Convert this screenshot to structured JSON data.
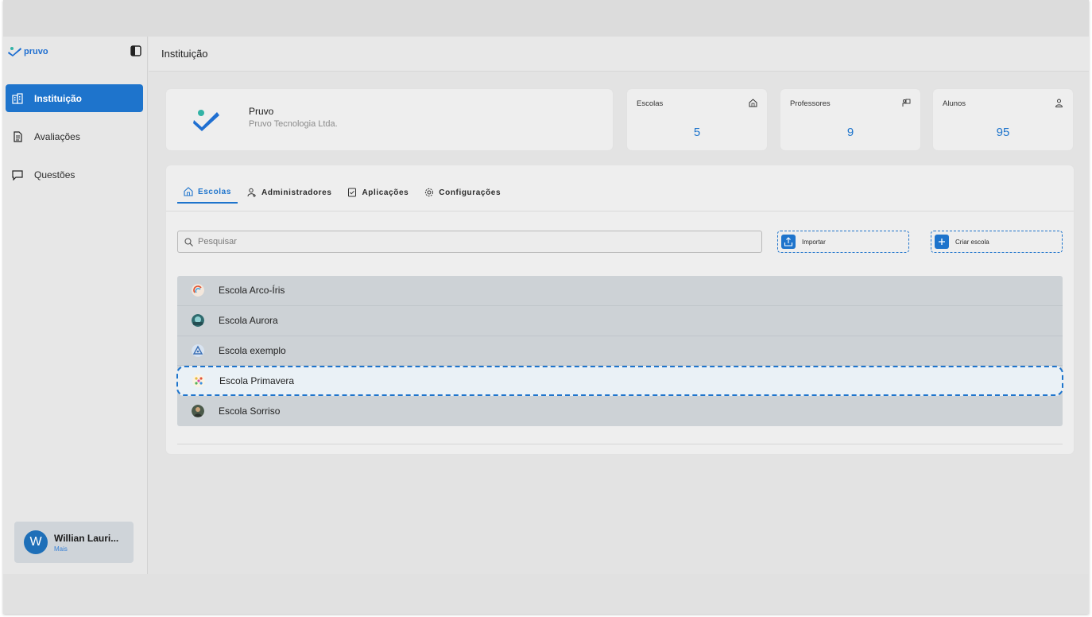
{
  "sidebar": {
    "logo_text": "pruvo",
    "items": [
      {
        "label": "Instituição",
        "icon": "building-icon",
        "active": true
      },
      {
        "label": "Avaliações",
        "icon": "document-icon",
        "active": false
      },
      {
        "label": "Questões",
        "icon": "chat-icon",
        "active": false
      }
    ],
    "user": {
      "initial": "W",
      "name": "Willian Lauri...",
      "sub": "Mais"
    }
  },
  "header": {
    "title": "Instituição"
  },
  "org": {
    "name": "Pruvo",
    "company": "Pruvo Tecnologia Ltda."
  },
  "stats": [
    {
      "label": "Escolas",
      "value": "5",
      "icon": "home-icon"
    },
    {
      "label": "Professores",
      "value": "9",
      "icon": "teacher-icon"
    },
    {
      "label": "Alunos",
      "value": "95",
      "icon": "person-icon"
    }
  ],
  "tabs": [
    {
      "label": "Escolas",
      "icon": "home-icon",
      "active": true
    },
    {
      "label": "Administradores",
      "icon": "admin-icon",
      "active": false
    },
    {
      "label": "Aplicações",
      "icon": "checklist-icon",
      "active": false
    },
    {
      "label": "Configurações",
      "icon": "gear-icon",
      "active": false
    }
  ],
  "search": {
    "placeholder": "Pesquisar"
  },
  "actions": {
    "import_label": "Importar",
    "create_label": "Criar escola"
  },
  "schools": [
    {
      "name": "Escola Arco-Íris",
      "color": "#e07a2e"
    },
    {
      "name": "Escola Aurora",
      "color": "#2f6b6e"
    },
    {
      "name": "Escola exemplo",
      "color": "#3a6fb5"
    },
    {
      "name": "Escola Primavera",
      "color": "#e6b93c",
      "highlighted": true
    },
    {
      "name": "Escola Sorriso",
      "color": "#4b5a4a"
    }
  ],
  "colors": {
    "accent": "#1e74cc"
  }
}
